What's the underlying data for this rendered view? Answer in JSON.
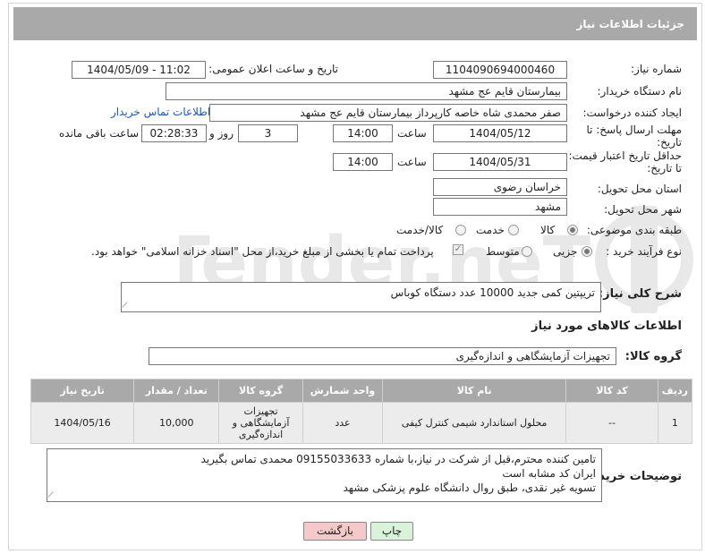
{
  "header": {
    "title": "جزئیات اطلاعات نیاز"
  },
  "fields": {
    "need_number_label": "شماره نیاز:",
    "need_number": "1104090694000460",
    "announce_label": "تاریخ و ساعت اعلان عمومی:",
    "announce_value": "1404/05/09 - 11:02",
    "buyer_org_label": "نام دستگاه خریدار:",
    "buyer_org": "بیمارستان قایم  عج  مشهد",
    "creator_label": "ایجاد کننده درخواست:",
    "creator": "صفر محمدی شاه خاصه کارپرداز بیمارستان قایم  عج  مشهد",
    "contact_link": "اطلاعات تماس خریدار",
    "deadline_label_1": "مهلت ارسال پاسخ: تا",
    "deadline_label_2": "تاریخ:",
    "deadline_date": "1404/05/12",
    "time_label": "ساعت",
    "deadline_time": "14:00",
    "days_value": "3",
    "days_label": "روز و",
    "remaining_time": "02:28:33",
    "remaining_label": "ساعت باقی مانده",
    "price_label_1": "حداقل تاریخ اعتبار قیمت:",
    "price_label_2": "تا تاریخ:",
    "price_date": "1404/05/31",
    "price_time": "14:00",
    "province_label": "استان محل تحویل:",
    "province": "خراسان رضوی",
    "city_label": "شهر محل تحویل:",
    "city": "مشهد",
    "category_label": "طبقه بندی موضوعی:",
    "category_options": [
      "کالا",
      "خدمت",
      "کالا/خدمت"
    ],
    "purchase_label": "نوع فرآیند خرید :",
    "purchase_options": [
      "جزیی",
      "متوسط"
    ],
    "payment_note": "پرداخت تمام یا بخشی از مبلغ خرید،از محل \"اسناد خزانه اسلامی\" خواهد بود.",
    "description_label": "شرح کلی نیاز:",
    "description": "تریپتین کمی جدید 10000 عدد دستگاه کوباس"
  },
  "goods": {
    "section_title": "اطلاعات کالاهای مورد نیاز",
    "group_label": "گروه کالا:",
    "group_value": "تجهیزات آزمایشگاهی و اندازه‌گیری",
    "columns": [
      "ردیف",
      "کد کالا",
      "نام کالا",
      "واحد شمارش",
      "گروه کالا",
      "تعداد / مقدار",
      "تاریخ نیاز"
    ],
    "rows": [
      {
        "row": "1",
        "code": "--",
        "name": "محلول استاندارد شیمی کنترل کیفی",
        "unit": "عدد",
        "group": "تجهیزات آزمایشگاهی و اندازه‌گیری",
        "qty": "10,000",
        "date": "1404/05/16"
      }
    ]
  },
  "notes": {
    "label": "توضیحات خریدار:",
    "lines": [
      "تامین کننده محترم،قبل از شرکت در نیاز،با شماره 09155033633 محمدی تماس بگیرید",
      "ایران کد مشابه است",
      "تسویه غیر نقدی، طبق روال دانشگاه علوم پزشکی مشهد"
    ]
  },
  "buttons": {
    "print": "چاپ",
    "back": "بازگشت"
  },
  "watermark_text": "AriaTender.neT",
  "colors": {
    "header_bg": "#a9a9a9",
    "link": "#1a56c4",
    "back_button": "#f4c9c9",
    "print_button": "#d9f2d9"
  }
}
